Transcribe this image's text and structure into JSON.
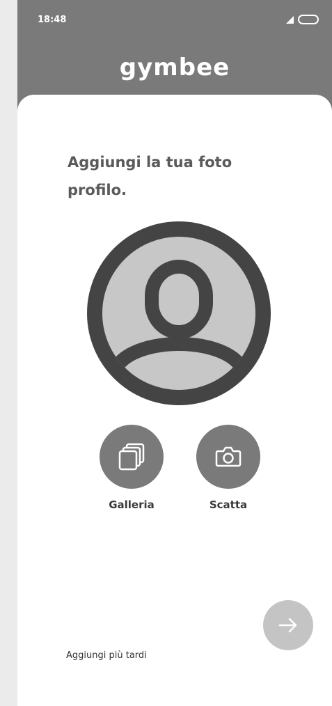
{
  "status_bar": {
    "time": "18:48",
    "icons": [
      "signal-icon",
      "battery-icon"
    ]
  },
  "header": {
    "logo_text": "gymbee"
  },
  "main": {
    "title": "Aggiungi la tua foto profilo.",
    "avatar_icon": "user-avatar-icon",
    "actions": [
      {
        "label": "Galleria",
        "icon": "gallery-stack-icon"
      },
      {
        "label": "Scatta",
        "icon": "camera-icon"
      }
    ],
    "next_icon": "arrow-right-icon",
    "later_label": "Aggiungi più tardi"
  },
  "colors": {
    "header_background": "#7a7a7a",
    "card_background": "#ffffff",
    "avatar_ring": "#444444",
    "avatar_fill": "#c7c7c7",
    "action_button": "#7a7a7a",
    "next_button": "#c4c4c4"
  }
}
